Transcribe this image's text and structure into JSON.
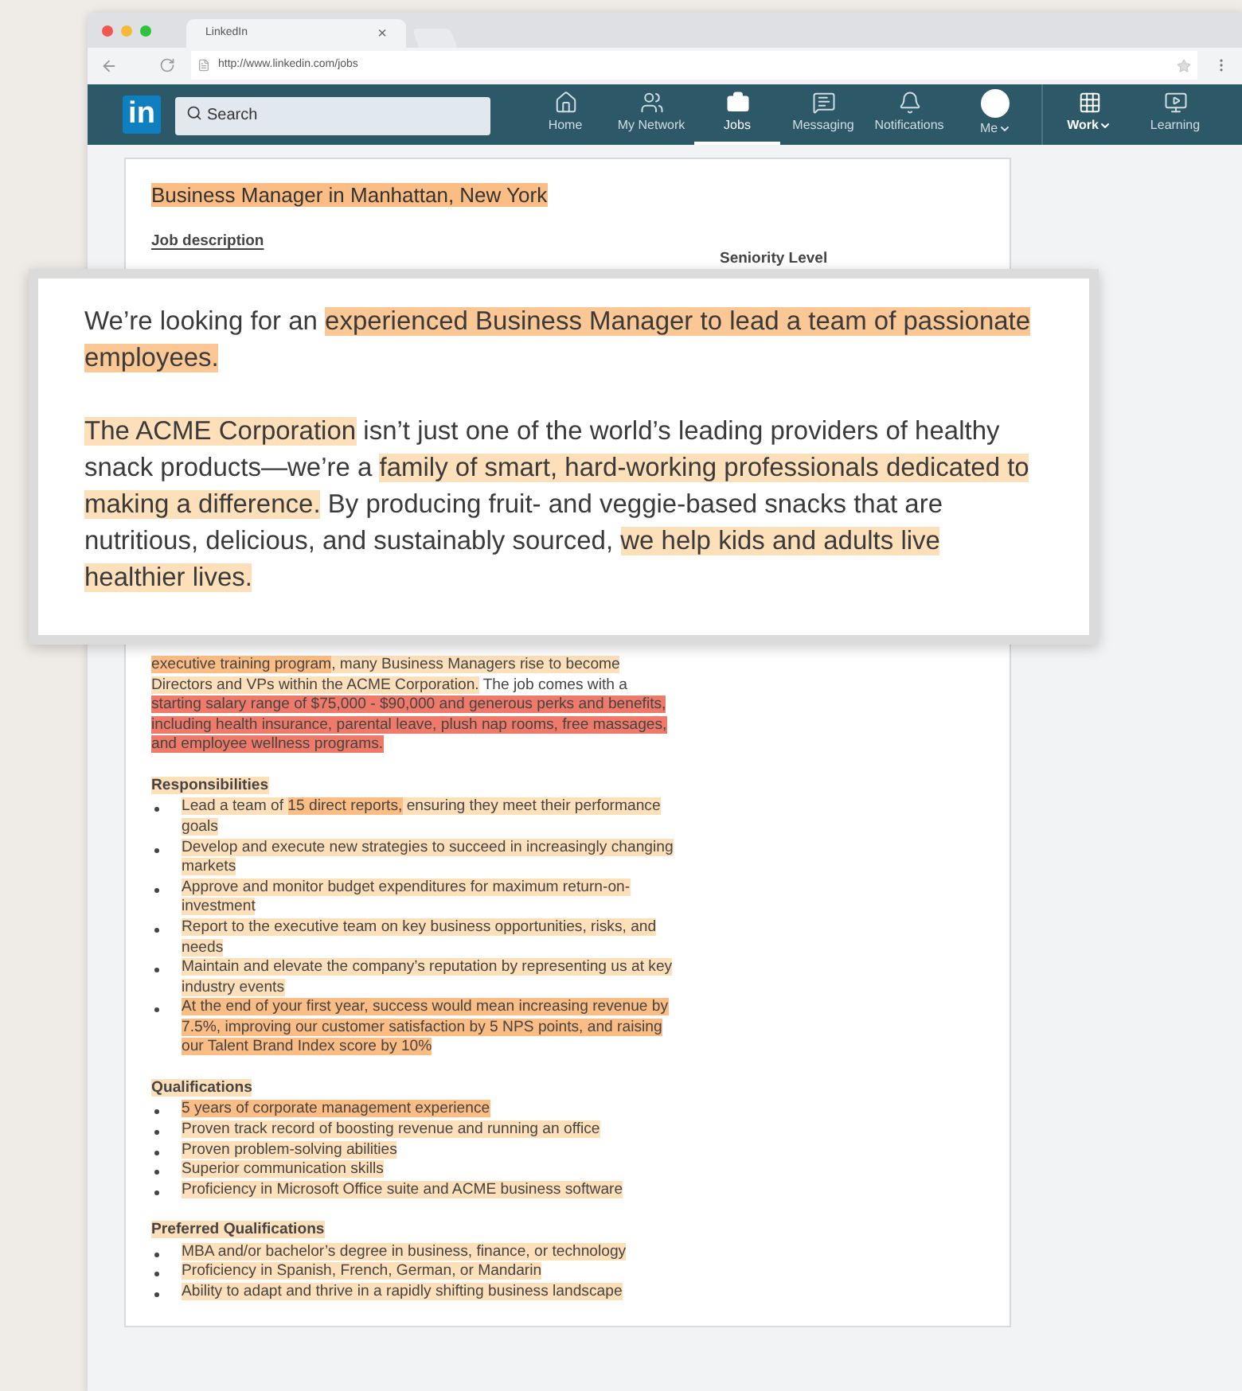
{
  "browser": {
    "tabs": [
      {
        "title": "LinkedIn",
        "close": "×",
        "selected": true
      }
    ],
    "url": "http://www.linkedin.com/jobs"
  },
  "nav": {
    "logo": "in",
    "search": {
      "placeholder": "Search"
    },
    "items": [
      {
        "label": "Home",
        "selected": false,
        "caret": false
      },
      {
        "label": "My Network",
        "selected": false,
        "caret": false
      },
      {
        "label": "Jobs",
        "selected": true,
        "caret": false
      },
      {
        "label": "Messaging",
        "selected": false,
        "caret": false
      },
      {
        "label": "Notifications",
        "selected": false,
        "caret": false
      },
      {
        "label": "Me",
        "selected": false,
        "caret": true
      },
      {
        "label": "Work",
        "selected": false,
        "caret": true
      },
      {
        "label": "Learning",
        "selected": false,
        "caret": false
      }
    ]
  },
  "job": {
    "title": [
      {
        "text": "Business Manager in Manhattan, New York",
        "color": "#fbbd84"
      }
    ],
    "section_tab": "Job description",
    "side_heading": "Seniority Level",
    "paragraph": [
      {
        "text": "executive training program",
        "color": "#fbbd84"
      },
      {
        "text": ", many Business Managers rise to become Directors and VPs within the ACME Corporation.",
        "color": "#fde0ba"
      },
      {
        "text": " The job comes with a "
      },
      {
        "text": "starting salary range of $75,000 - $90,000 and generous perks and benefits, including health insurance, parental leave, plush nap rooms, free massages, and employee wellness programs.",
        "color": "#ef7a6a"
      }
    ],
    "sections": [
      {
        "heading": [
          {
            "text": "Responsibilities",
            "color": "#fde0ba"
          }
        ],
        "items": [
          [
            {
              "text": "Lead a team of ",
              "color": "#fde0ba"
            },
            {
              "text": "15 direct reports,",
              "color": "#fbbd84"
            },
            {
              "text": " ensuring they meet their performance goals",
              "color": "#fde0ba"
            }
          ],
          [
            {
              "text": "Develop and execute new strategies to succeed in increasingly changing markets",
              "color": "#fde0ba"
            }
          ],
          [
            {
              "text": "Approve and monitor budget expenditures for maximum return-on-investment",
              "color": "#fde0ba"
            }
          ],
          [
            {
              "text": "Report to the executive team on key business opportunities, risks, and needs",
              "color": "#fde0ba"
            }
          ],
          [
            {
              "text": "Maintain and elevate the company’s reputation by representing us at key industry events",
              "color": "#fde0ba"
            }
          ],
          [
            {
              "text": "At the end of your first year, success would mean increasing revenue by 7.5%, improving our customer satisfaction by 5 NPS points, and raising our Talent Brand Index score by 10%",
              "color": "#fbbd84"
            }
          ]
        ]
      },
      {
        "heading": [
          {
            "text": "Qualifications",
            "color": "#fde0ba"
          }
        ],
        "items": [
          [
            {
              "text": "5 years of corporate management experience",
              "color": "#fbbd84"
            }
          ],
          [
            {
              "text": "Proven track record of boosting revenue and running an office",
              "color": "#fde0ba"
            }
          ],
          [
            {
              "text": "Proven problem-solving abilities",
              "color": "#fde0ba"
            }
          ],
          [
            {
              "text": "Superior communication skills",
              "color": "#fde0ba"
            }
          ],
          [
            {
              "text": "Proficiency in Microsoft Office suite and ACME business software",
              "color": "#fde0ba"
            }
          ]
        ]
      },
      {
        "heading": [
          {
            "text": "Preferred Qualifications",
            "color": "#fde0ba"
          }
        ],
        "items": [
          [
            {
              "text": "MBA and/or bachelor’s degree in business, finance, or technology",
              "color": "#fde0ba"
            }
          ],
          [
            {
              "text": "Proficiency in Spanish, French, German, or Mandarin",
              "color": "#fde0ba"
            }
          ],
          [
            {
              "text": "Ability to adapt and thrive in a rapidly shifting business landscape",
              "color": "#fde0ba"
            }
          ]
        ]
      }
    ]
  },
  "callout": {
    "paragraphs": [
      [
        {
          "text": "We’re looking for an "
        },
        {
          "text": "experienced Business Manager to lead a team of passionate employees.",
          "color": "#fbc795"
        }
      ],
      [
        {
          "text": "The ACME Corporation",
          "color": "#fde0ba"
        },
        {
          "text": " isn’t just one of the world’s leading providers of healthy snack products—we’re a "
        },
        {
          "text": "family of smart, hard-working professionals dedicated to making a difference.",
          "color": "#fde0ba"
        },
        {
          "text": " By producing fruit- and veggie-based snacks that are nutritious, delicious, and sustainably sourced, "
        },
        {
          "text": "we help kids and adults live healthier lives.",
          "color": "#fde0ba"
        }
      ]
    ]
  }
}
